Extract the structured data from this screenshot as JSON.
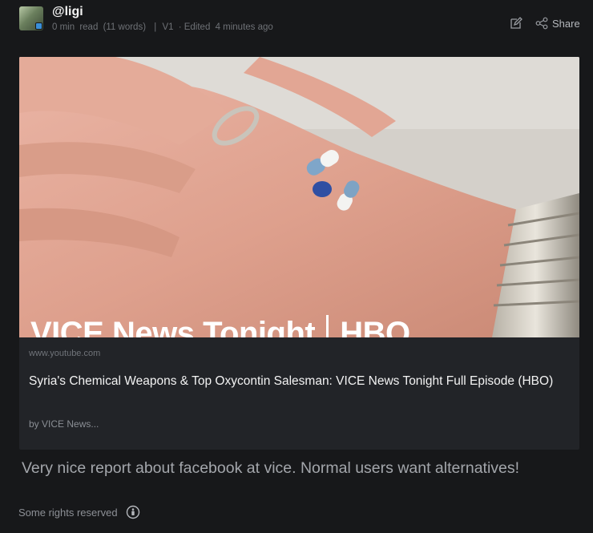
{
  "author": {
    "handle": "@ligi"
  },
  "meta": {
    "read_time": "0 min",
    "read_label": "read",
    "word_count": "(11 words)",
    "separator": "|",
    "version": "V1",
    "edited": "· Edited",
    "edited_when": "4 minutes ago"
  },
  "actions": {
    "share_label": "Share"
  },
  "link_card": {
    "thumbnail_overlay_left": "VICE News Tonight",
    "thumbnail_overlay_right": "HBO",
    "domain": "www.youtube.com",
    "title": "Syria's Chemical Weapons & Top Oxycontin Salesman: VICE News Tonight Full Episode (HBO)",
    "byline": "by VICE News..."
  },
  "post": {
    "text": "Very nice report about facebook at vice. Normal users want alternatives!"
  },
  "footer": {
    "license": "Some rights reserved"
  }
}
